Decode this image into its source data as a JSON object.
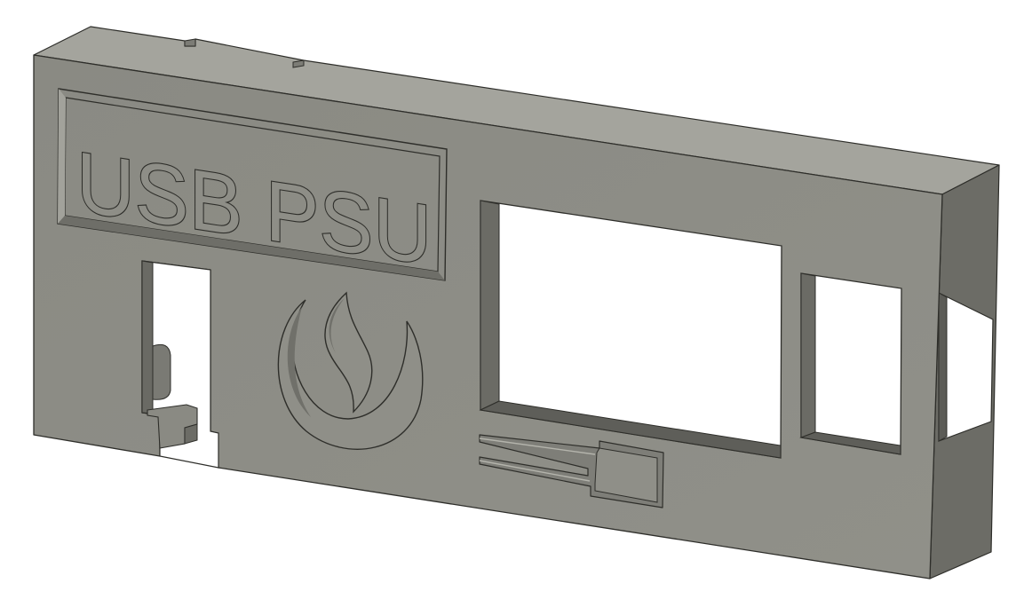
{
  "model": {
    "label_text": "USB PSU"
  },
  "colors": {
    "background": "#ffffff",
    "front_face": "#8d8d86",
    "top_face": "#a4a49d",
    "side_face": "#6c6c66",
    "recess_dark": "#55554f",
    "recess_light": "#b4b4ac",
    "edge_line": "#2e2e2a"
  },
  "icons": {
    "flame_logo": "flame-crescent-logo"
  }
}
